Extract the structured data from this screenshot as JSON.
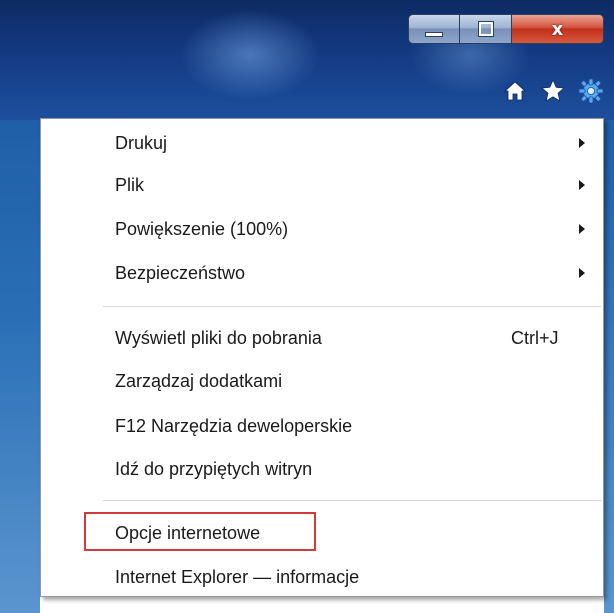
{
  "window": {
    "caption_buttons": {
      "minimize_icon": "minimize-icon",
      "maximize_icon": "restore-icon",
      "close_label": "x"
    },
    "toolbar_icons": [
      "home-icon",
      "favorites-star-icon",
      "tools-gear-icon"
    ]
  },
  "menu": {
    "items": [
      {
        "label": "Drukuj",
        "has_submenu": true
      },
      {
        "label": "Plik",
        "has_submenu": true
      },
      {
        "label": "Powiększenie (100%)",
        "has_submenu": true
      },
      {
        "label": "Bezpieczeństwo",
        "has_submenu": true
      },
      {
        "label": "Wyświetl pliki do pobrania",
        "shortcut": "Ctrl+J"
      },
      {
        "label": "Zarządzaj dodatkami"
      },
      {
        "label": "F12 Narzędzia deweloperskie"
      },
      {
        "label": "Idź do przypiętych witryn"
      },
      {
        "label": "Opcje internetowe",
        "highlighted": true
      },
      {
        "label": "Internet Explorer — informacje"
      }
    ]
  },
  "colors": {
    "highlight_border": "#d23b3b",
    "titlebar": "#143a82",
    "menu_background": "#ffffff"
  }
}
